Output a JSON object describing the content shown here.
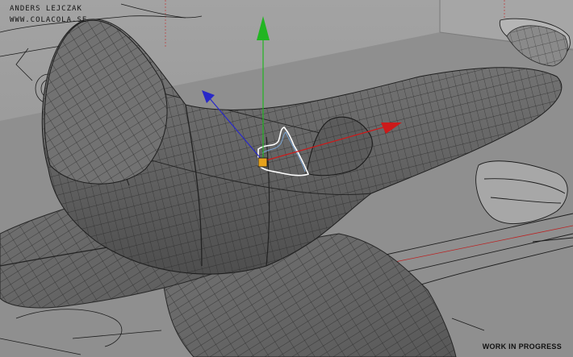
{
  "overlay": {
    "author": "ANDERS LEJCZAK",
    "website": "WWW.COLACOLA.SE",
    "status": "WORK IN PROGRESS"
  },
  "viewport": {
    "background_color": "#9a9a9a",
    "floor_color": "#8c8c8c",
    "mesh_fill_color": "#6b6b6b",
    "mesh_wire_color": "#2a2a2a",
    "blueprint_line_color": "#1c1c1c",
    "selection_color": "#ffffff"
  },
  "gizmo": {
    "x_axis_color": "#cc1a1a",
    "y_axis_color": "#22b522",
    "z_axis_color": "#2828c8",
    "pivot_color": "#e6a21c"
  }
}
